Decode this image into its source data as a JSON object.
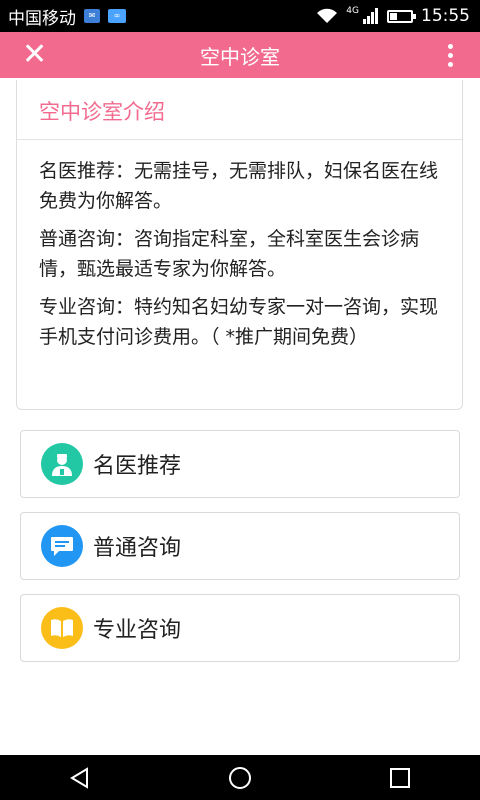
{
  "status_bar": {
    "carrier": "中国移动",
    "network": "4G",
    "time": "15:55",
    "battery_level": 0.35
  },
  "header": {
    "title": "空中诊室"
  },
  "intro": {
    "title": "空中诊室介绍",
    "paragraphs": [
      "名医推荐：无需挂号，无需排队，妇保名医在线免费为你解答。",
      "普通咨询：咨询指定科室，全科室医生会诊病情，甄选最适专家为你解答。",
      "专业咨询：特约知名妇幼专家一对一咨询，实现手机支付问诊费用。（ *推广期间免费）"
    ]
  },
  "menu": [
    {
      "label": "名医推荐",
      "icon": "doctor-icon",
      "color": "#22c7a4"
    },
    {
      "label": "普通咨询",
      "icon": "chat-icon",
      "color": "#2196f3"
    },
    {
      "label": "专业咨询",
      "icon": "book-icon",
      "color": "#fbbd18"
    }
  ],
  "colors": {
    "accent": "#f26b8f",
    "status_bar": "#000000"
  }
}
